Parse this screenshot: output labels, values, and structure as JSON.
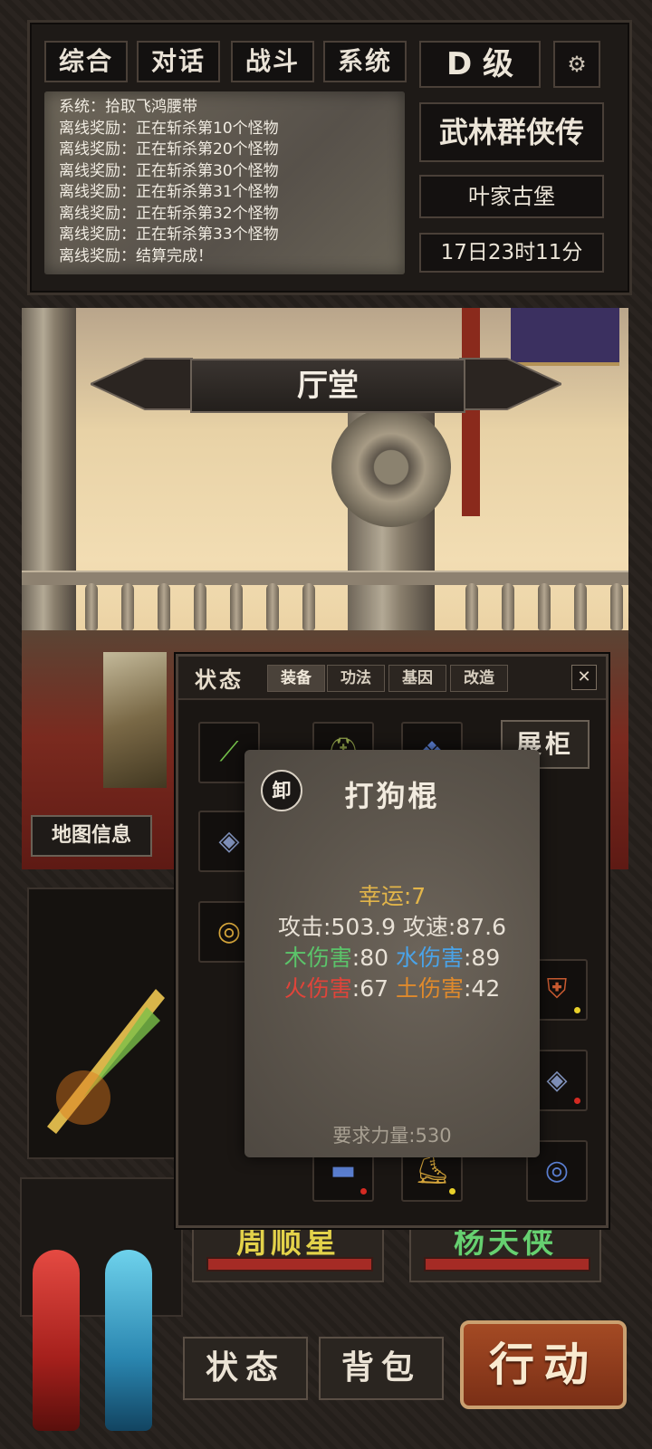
{
  "chat_tabs": [
    "综合",
    "对话",
    "战斗",
    "系统"
  ],
  "rank": "D 级",
  "settings_icon": "gear-icon",
  "log_lines": [
    "系统：拾取飞鸿腰带",
    "离线奖励：正在斩杀第10个怪物",
    "离线奖励：正在斩杀第20个怪物",
    "离线奖励：正在斩杀第30个怪物",
    "离线奖励：正在斩杀第31个怪物",
    "离线奖励：正在斩杀第32个怪物",
    "离线奖励：正在斩杀第33个怪物",
    "离线奖励：结算完成！"
  ],
  "game_title": "武林群侠传",
  "location": "叶家古堡",
  "game_time": "17日23时11分",
  "scene_name": "厅堂",
  "map_info_label": "地图信息",
  "panel": {
    "title": "状态",
    "tabs": [
      "装备",
      "功法",
      "基因",
      "改造"
    ],
    "active_tab": "装备",
    "close_label": "✕",
    "showcase_label": "展柜"
  },
  "tooltip": {
    "badge": "卸",
    "item_name": "打狗棍",
    "luck": "幸运:7",
    "attack_line": "攻击:503.9 攻速:87.6",
    "wood_label": "木伤害",
    "wood_value": ":80",
    "water_label": "水伤害",
    "water_value": ":89",
    "fire_label": "火伤害",
    "fire_value": ":67",
    "earth_label": "土伤害",
    "earth_value": ":42",
    "requirement": "要求力量:530",
    "colors": {
      "luck": "#e2b54a",
      "wood": "#5bc46a",
      "water": "#4aa3e8",
      "fire": "#e0443a",
      "earth": "#e08a2c"
    }
  },
  "heroes": [
    {
      "name": "周顺星",
      "color": "#e3d24a"
    },
    {
      "name": "杨天侠",
      "color": "#66d070"
    }
  ],
  "bottom_buttons": {
    "status": "状态",
    "bag": "背包",
    "action": "行动"
  }
}
